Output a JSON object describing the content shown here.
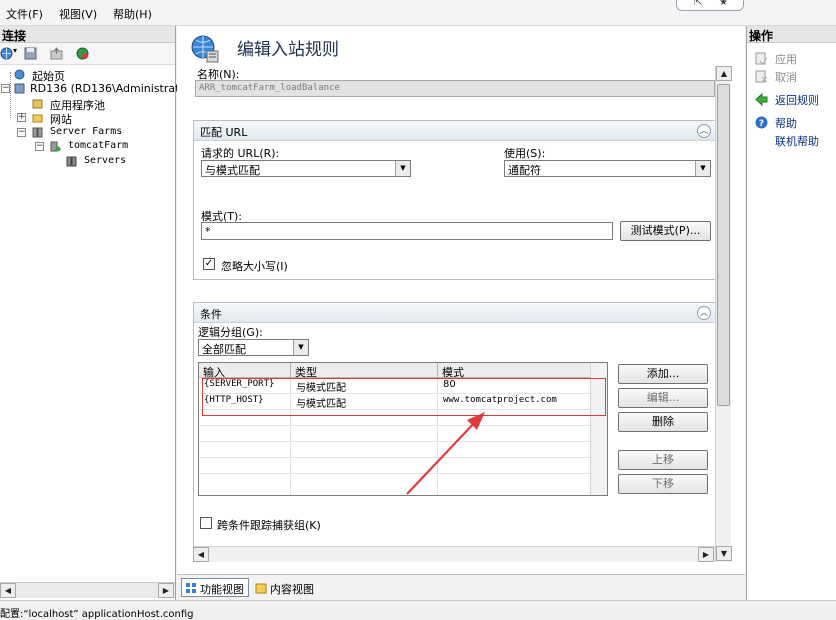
{
  "menu": {
    "file": "文件(F)",
    "view": "视图(V)",
    "help": "帮助(H)"
  },
  "window_controls": {
    "resize": "⇱",
    "star": "★"
  },
  "connections": {
    "title": "连接",
    "tree": [
      {
        "label": "起始页"
      },
      {
        "label": "RD136 (RD136\\Administrator)"
      },
      {
        "label": "应用程序池"
      },
      {
        "label": "网站"
      },
      {
        "label": "Server Farms"
      },
      {
        "label": "tomcatFarm"
      },
      {
        "label": "Servers"
      }
    ]
  },
  "main": {
    "page_title": "编辑入站规则",
    "name_label": "名称(N):",
    "name_value": "ARR_tomcatFarm_loadBalance",
    "match_url": {
      "header": "匹配 URL",
      "requested_url_label": "请求的 URL(R):",
      "requested_url_value": "与模式匹配",
      "using_label": "使用(S):",
      "using_value": "通配符",
      "pattern_label": "模式(T):",
      "pattern_value": "*",
      "test_button": "测试模式(P)...",
      "ignore_case_label": "忽略大小写(I)",
      "ignore_case_checked": true
    },
    "conditions": {
      "header": "条件",
      "logical_group_label": "逻辑分组(G):",
      "logical_group_value": "全部匹配",
      "columns": [
        "输入",
        "类型",
        "模式"
      ],
      "rows": [
        {
          "input": "{SERVER_PORT}",
          "type": "与模式匹配",
          "pattern": "80"
        },
        {
          "input": "{HTTP_HOST}",
          "type": "与模式匹配",
          "pattern": "www.tomcatproject.com"
        }
      ],
      "buttons": {
        "add": "添加...",
        "edit": "编辑...",
        "delete": "删除",
        "move_up": "上移",
        "move_down": "下移"
      },
      "track_captures_label": "跨条件跟踪捕获组(K)",
      "track_captures_checked": false
    },
    "view_tabs": {
      "features": "功能视图",
      "content": "内容视图"
    }
  },
  "actions": {
    "title": "操作",
    "apply": "应用",
    "cancel": "取消",
    "back_to_rules": "返回规则",
    "help": "帮助",
    "online_help": "联机帮助"
  },
  "status_bar": "配置:“localhost” applicationHost.config",
  "colors": {
    "highlight_box": "#e0393e",
    "arrow": "#e0393e",
    "selection": "#0a246a"
  }
}
